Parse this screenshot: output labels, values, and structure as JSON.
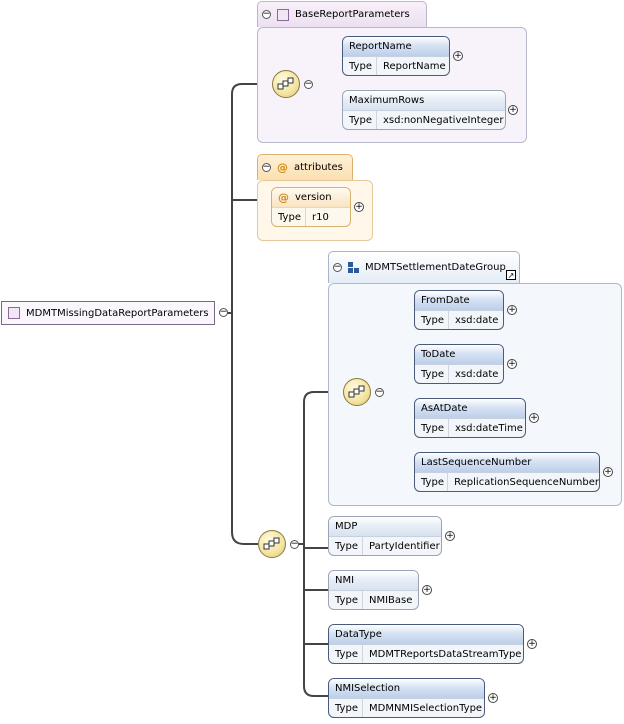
{
  "root": {
    "label": "MDMTMissingDataReportParameters"
  },
  "base_group": {
    "label": "BaseReportParameters"
  },
  "attributes_group": {
    "label": "attributes"
  },
  "settlement_group": {
    "label": "MDMTSettlementDateGroup"
  },
  "type_key": "Type",
  "elements": {
    "report_name": {
      "name": "ReportName",
      "type": "ReportName"
    },
    "maximum_rows": {
      "name": "MaximumRows",
      "type": "xsd:nonNegativeInteger"
    },
    "version": {
      "name": "version",
      "type": "r10"
    },
    "from_date": {
      "name": "FromDate",
      "type": "xsd:date"
    },
    "to_date": {
      "name": "ToDate",
      "type": "xsd:date"
    },
    "as_at_date": {
      "name": "AsAtDate",
      "type": "xsd:dateTime"
    },
    "last_sequence_number": {
      "name": "LastSequenceNumber",
      "type": "ReplicationSequenceNumber"
    },
    "mdp": {
      "name": "MDP",
      "type": "PartyIdentifier"
    },
    "nmi": {
      "name": "NMI",
      "type": "NMIBase"
    },
    "data_type": {
      "name": "DataType",
      "type": "MDMTReportsDataStreamType"
    },
    "nmi_selection": {
      "name": "NMISelection",
      "type": "MDMNMISelectionType"
    }
  },
  "icons": {
    "sequence": "sequence-compositor-icon",
    "group": "group-icon",
    "expand": "plus-icon",
    "collapse": "minus-icon"
  }
}
